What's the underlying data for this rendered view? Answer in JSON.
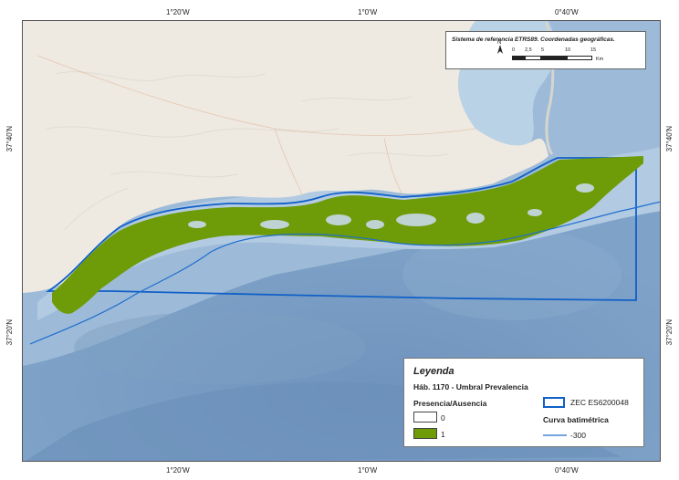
{
  "map": {
    "lon_ticks": [
      "1°20'W",
      "1°0'W",
      "0°40'W"
    ],
    "lat_ticks": [
      "37°40'N",
      "37°20'N"
    ],
    "colors": {
      "land": "#eeeae2",
      "sea_light": "#b7cde2",
      "sea_mid": "#8eb0d0",
      "sea_deep": "#6f93bd",
      "presence": "#6d9c08",
      "absence": "#ffffff",
      "zec_outline": "#1060c8",
      "bathymetry": "#1f6ed0"
    }
  },
  "scale_box": {
    "reference_text": "Sistema de referencia ETRS89. Coordenadas geográficas.",
    "north_label": "N",
    "scale_labels": [
      "0",
      "2,5",
      "5",
      "10",
      "15"
    ],
    "unit": "Km"
  },
  "legend": {
    "title": "Leyenda",
    "subtitle": "Háb. 1170 - Umbral Prevalencia",
    "presence_header": "Presencia/Ausencia",
    "item_0": "0",
    "item_1": "1",
    "zec_label": "ZEC ES6200048",
    "bathymetry_header": "Curva batimétrica",
    "bathymetry_item": "-300"
  }
}
